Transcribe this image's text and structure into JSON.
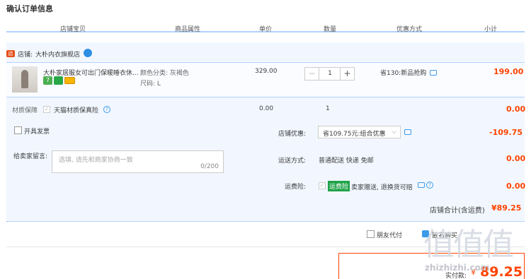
{
  "page": {
    "title": "确认订单信息"
  },
  "columns": [
    "店铺宝贝",
    "商品属性",
    "单价",
    "数量",
    "优惠方式",
    "小计"
  ],
  "shop": {
    "label": "店铺:",
    "name": "大朴内衣旗舰店"
  },
  "item": {
    "name": "大朴家居服女可出门保暖睡衣休...",
    "attr_color": "颜色分类: 灰褐色",
    "attr_size": "尺码: L",
    "price": "329.00",
    "quantity": "1",
    "promo": "省130:新品抢购",
    "subtotal": "199.00",
    "badge7": "7"
  },
  "insurance": {
    "label": "材质保障",
    "option": "天猫材质保真险",
    "price": "0.00",
    "qty": "1",
    "subtotal": "0.00"
  },
  "invoice": {
    "label": "开具发票"
  },
  "shop_discount": {
    "label": "店铺优惠:",
    "selected": "省109.75元:组合优惠",
    "amount": "-109.75"
  },
  "message": {
    "label": "给卖家留言:",
    "placeholder": "选填, 请先和商家协商一致",
    "counter": "0/200"
  },
  "shipping": {
    "label": "运送方式:",
    "value": "普通配送 快递 免邮",
    "amount": "0.00"
  },
  "freight_ins": {
    "label": "运费险:",
    "tag": "运费险",
    "desc": "卖家赠送, 退换货可赔",
    "amount": "0.00"
  },
  "shop_total": {
    "label": "店铺合计(含运费)",
    "amount": "¥89.25"
  },
  "footer": {
    "friend_pay": "朋友代付",
    "anon": "匿名购买",
    "pay_label": "实付款:",
    "pay_currency": "¥",
    "pay_amount": "89.25"
  },
  "watermark": {
    "text": "zhizhizhi.com",
    "glyphs": "值值值"
  },
  "colors": {
    "accent_red": "#ff4400",
    "header_blue": "#b2d1ff",
    "order_bg": "#f2f7ff",
    "tag_green": "#1fa348"
  }
}
